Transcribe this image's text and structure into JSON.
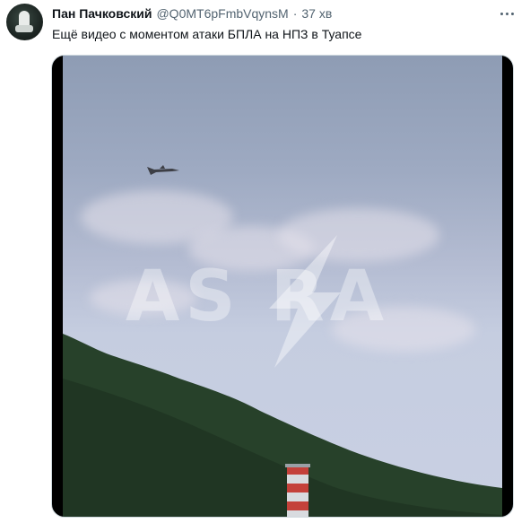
{
  "tweet": {
    "author_name": "Пан Пачковский",
    "author_handle": "@Q0MT6pFmbVqynsM",
    "separator": "·",
    "time": "37 хв",
    "text": "Ещё видео с моментом атаки БПЛА на НПЗ в Туапсе"
  },
  "media": {
    "watermark_text": "AS RA"
  },
  "icons": {
    "avatar": "avatar",
    "more": "more-icon",
    "drone": "drone-icon",
    "chimney": "chimney-icon"
  },
  "colors": {
    "text_primary": "#0f1419",
    "text_secondary": "#536471",
    "media_border": "#cfd9de",
    "mountain": "#27412a"
  }
}
